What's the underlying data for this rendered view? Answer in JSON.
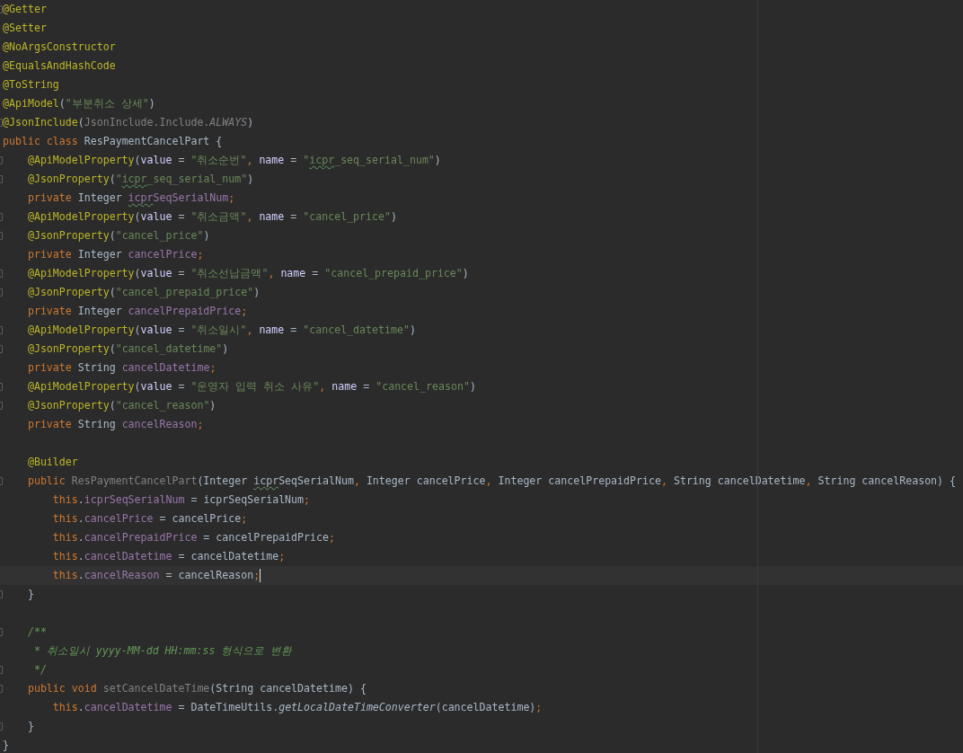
{
  "editor": {
    "lines": [
      {
        "fold": true,
        "current": false,
        "tokens": [
          {
            "kind": "annotation",
            "text": "@Getter"
          }
        ]
      },
      {
        "fold": false,
        "current": false,
        "tokens": [
          {
            "kind": "annotation",
            "text": "@Setter"
          }
        ]
      },
      {
        "fold": false,
        "current": false,
        "tokens": [
          {
            "kind": "annotation",
            "text": "@NoArgsConstructor"
          }
        ]
      },
      {
        "fold": false,
        "current": false,
        "tokens": [
          {
            "kind": "annotation",
            "text": "@EqualsAndHashCode"
          }
        ]
      },
      {
        "fold": false,
        "current": false,
        "tokens": [
          {
            "kind": "annotation",
            "text": "@ToString"
          }
        ]
      },
      {
        "fold": false,
        "current": false,
        "tokens": [
          {
            "kind": "annotation",
            "text": "@ApiModel"
          },
          {
            "kind": "plain",
            "text": "("
          },
          {
            "kind": "string",
            "text": "\"부분취소 상세\""
          },
          {
            "kind": "plain",
            "text": ")"
          }
        ]
      },
      {
        "fold": true,
        "current": false,
        "tokens": [
          {
            "kind": "annotation",
            "text": "@JsonInclude"
          },
          {
            "kind": "plain",
            "text": "("
          },
          {
            "kind": "unused",
            "text": "JsonInclude.Include."
          },
          {
            "kind": "constant",
            "text": "ALWAYS"
          },
          {
            "kind": "plain",
            "text": ")"
          }
        ]
      },
      {
        "fold": false,
        "current": false,
        "tokens": [
          {
            "kind": "keyword",
            "text": "public class "
          },
          {
            "kind": "plain",
            "text": "ResPaymentCancelPart {"
          }
        ]
      },
      {
        "fold": true,
        "current": false,
        "tokens": [
          {
            "kind": "annotation",
            "text": "    @ApiModelProperty"
          },
          {
            "kind": "plain",
            "text": "("
          },
          {
            "kind": "named",
            "text": "value"
          },
          {
            "kind": "plain",
            "text": " = "
          },
          {
            "kind": "string",
            "text": "\"취소순번\""
          },
          {
            "kind": "keyword",
            "text": ", "
          },
          {
            "kind": "named",
            "text": "name"
          },
          {
            "kind": "plain",
            "text": " = "
          },
          {
            "kind": "string",
            "text": "\""
          },
          {
            "kind": "string-typo",
            "text": "icpr"
          },
          {
            "kind": "string",
            "text": "_seq_serial_num\""
          },
          {
            "kind": "plain",
            "text": ")"
          }
        ]
      },
      {
        "fold": true,
        "current": false,
        "tokens": [
          {
            "kind": "annotation",
            "text": "    @JsonProperty"
          },
          {
            "kind": "plain",
            "text": "("
          },
          {
            "kind": "string",
            "text": "\""
          },
          {
            "kind": "string-typo",
            "text": "icpr"
          },
          {
            "kind": "string",
            "text": "_seq_serial_num\""
          },
          {
            "kind": "plain",
            "text": ")"
          }
        ]
      },
      {
        "fold": false,
        "current": false,
        "tokens": [
          {
            "kind": "keyword",
            "text": "    private "
          },
          {
            "kind": "plain",
            "text": "Integer "
          },
          {
            "kind": "field-typo",
            "text": "icpr"
          },
          {
            "kind": "field",
            "text": "SeqSerialNum"
          },
          {
            "kind": "keyword",
            "text": ";"
          }
        ]
      },
      {
        "fold": true,
        "current": false,
        "tokens": [
          {
            "kind": "annotation",
            "text": "    @ApiModelProperty"
          },
          {
            "kind": "plain",
            "text": "("
          },
          {
            "kind": "named",
            "text": "value"
          },
          {
            "kind": "plain",
            "text": " = "
          },
          {
            "kind": "string",
            "text": "\"취소금액\""
          },
          {
            "kind": "keyword",
            "text": ", "
          },
          {
            "kind": "named",
            "text": "name"
          },
          {
            "kind": "plain",
            "text": " = "
          },
          {
            "kind": "string",
            "text": "\"cancel_price\""
          },
          {
            "kind": "plain",
            "text": ")"
          }
        ]
      },
      {
        "fold": true,
        "current": false,
        "tokens": [
          {
            "kind": "annotation",
            "text": "    @JsonProperty"
          },
          {
            "kind": "plain",
            "text": "("
          },
          {
            "kind": "string",
            "text": "\"cancel_price\""
          },
          {
            "kind": "plain",
            "text": ")"
          }
        ]
      },
      {
        "fold": false,
        "current": false,
        "tokens": [
          {
            "kind": "keyword",
            "text": "    private "
          },
          {
            "kind": "plain",
            "text": "Integer "
          },
          {
            "kind": "field",
            "text": "cancelPrice"
          },
          {
            "kind": "keyword",
            "text": ";"
          }
        ]
      },
      {
        "fold": true,
        "current": false,
        "tokens": [
          {
            "kind": "annotation",
            "text": "    @ApiModelProperty"
          },
          {
            "kind": "plain",
            "text": "("
          },
          {
            "kind": "named",
            "text": "value"
          },
          {
            "kind": "plain",
            "text": " = "
          },
          {
            "kind": "string",
            "text": "\"취소선납금액\""
          },
          {
            "kind": "keyword",
            "text": ", "
          },
          {
            "kind": "named",
            "text": "name"
          },
          {
            "kind": "plain",
            "text": " = "
          },
          {
            "kind": "string",
            "text": "\"cancel_prepaid_price\""
          },
          {
            "kind": "plain",
            "text": ")"
          }
        ]
      },
      {
        "fold": true,
        "current": false,
        "tokens": [
          {
            "kind": "annotation",
            "text": "    @JsonProperty"
          },
          {
            "kind": "plain",
            "text": "("
          },
          {
            "kind": "string",
            "text": "\"cancel_prepaid_price\""
          },
          {
            "kind": "plain",
            "text": ")"
          }
        ]
      },
      {
        "fold": false,
        "current": false,
        "tokens": [
          {
            "kind": "keyword",
            "text": "    private "
          },
          {
            "kind": "plain",
            "text": "Integer "
          },
          {
            "kind": "field",
            "text": "cancelPrepaidPrice"
          },
          {
            "kind": "keyword",
            "text": ";"
          }
        ]
      },
      {
        "fold": true,
        "current": false,
        "tokens": [
          {
            "kind": "annotation",
            "text": "    @ApiModelProperty"
          },
          {
            "kind": "plain",
            "text": "("
          },
          {
            "kind": "named",
            "text": "value"
          },
          {
            "kind": "plain",
            "text": " = "
          },
          {
            "kind": "string",
            "text": "\"취소일시\""
          },
          {
            "kind": "keyword",
            "text": ", "
          },
          {
            "kind": "named",
            "text": "name"
          },
          {
            "kind": "plain",
            "text": " = "
          },
          {
            "kind": "string",
            "text": "\"cancel_datetime\""
          },
          {
            "kind": "plain",
            "text": ")"
          }
        ]
      },
      {
        "fold": true,
        "current": false,
        "tokens": [
          {
            "kind": "annotation",
            "text": "    @JsonProperty"
          },
          {
            "kind": "plain",
            "text": "("
          },
          {
            "kind": "string",
            "text": "\"cancel_datetime\""
          },
          {
            "kind": "plain",
            "text": ")"
          }
        ]
      },
      {
        "fold": false,
        "current": false,
        "tokens": [
          {
            "kind": "keyword",
            "text": "    private "
          },
          {
            "kind": "plain",
            "text": "String "
          },
          {
            "kind": "field",
            "text": "cancelDatetime"
          },
          {
            "kind": "keyword",
            "text": ";"
          }
        ]
      },
      {
        "fold": true,
        "current": false,
        "tokens": [
          {
            "kind": "annotation",
            "text": "    @ApiModelProperty"
          },
          {
            "kind": "plain",
            "text": "("
          },
          {
            "kind": "named",
            "text": "value"
          },
          {
            "kind": "plain",
            "text": " = "
          },
          {
            "kind": "string",
            "text": "\"운영자 입력 취소 사유\""
          },
          {
            "kind": "keyword",
            "text": ", "
          },
          {
            "kind": "named",
            "text": "name"
          },
          {
            "kind": "plain",
            "text": " = "
          },
          {
            "kind": "string",
            "text": "\"cancel_reason\""
          },
          {
            "kind": "plain",
            "text": ")"
          }
        ]
      },
      {
        "fold": true,
        "current": false,
        "tokens": [
          {
            "kind": "annotation",
            "text": "    @JsonProperty"
          },
          {
            "kind": "plain",
            "text": "("
          },
          {
            "kind": "string",
            "text": "\"cancel_reason\""
          },
          {
            "kind": "plain",
            "text": ")"
          }
        ]
      },
      {
        "fold": false,
        "current": false,
        "tokens": [
          {
            "kind": "keyword",
            "text": "    private "
          },
          {
            "kind": "plain",
            "text": "String "
          },
          {
            "kind": "field",
            "text": "cancelReason"
          },
          {
            "kind": "keyword",
            "text": ";"
          }
        ]
      },
      {
        "fold": false,
        "current": false
      },
      {
        "fold": false,
        "current": false,
        "tokens": [
          {
            "kind": "annotation",
            "text": "    @Builder"
          }
        ]
      },
      {
        "fold": true,
        "current": false,
        "tokens": [
          {
            "kind": "keyword",
            "text": "    public "
          },
          {
            "kind": "unused",
            "text": "ResPaymentCancelPart"
          },
          {
            "kind": "plain",
            "text": "(Integer "
          },
          {
            "kind": "plain-typo",
            "text": "icpr"
          },
          {
            "kind": "plain",
            "text": "SeqSerialNum"
          },
          {
            "kind": "keyword",
            "text": ", "
          },
          {
            "kind": "plain",
            "text": "Integer cancelPrice"
          },
          {
            "kind": "keyword",
            "text": ", "
          },
          {
            "kind": "plain",
            "text": "Integer cancelPrepaidPrice"
          },
          {
            "kind": "keyword",
            "text": ", "
          },
          {
            "kind": "plain",
            "text": "String cancelDatetime"
          },
          {
            "kind": "keyword",
            "text": ", "
          },
          {
            "kind": "plain",
            "text": "String cancelReason) {"
          }
        ]
      },
      {
        "fold": false,
        "current": false,
        "tokens": [
          {
            "kind": "keyword",
            "text": "        this"
          },
          {
            "kind": "plain",
            "text": "."
          },
          {
            "kind": "field",
            "text": "icprSeqSerialNum"
          },
          {
            "kind": "plain",
            "text": " = icprSeqSerialNum"
          },
          {
            "kind": "keyword",
            "text": ";"
          }
        ]
      },
      {
        "fold": false,
        "current": false,
        "tokens": [
          {
            "kind": "keyword",
            "text": "        this"
          },
          {
            "kind": "plain",
            "text": "."
          },
          {
            "kind": "field",
            "text": "cancelPrice"
          },
          {
            "kind": "plain",
            "text": " = cancelPrice"
          },
          {
            "kind": "keyword",
            "text": ";"
          }
        ]
      },
      {
        "fold": false,
        "current": false,
        "tokens": [
          {
            "kind": "keyword",
            "text": "        this"
          },
          {
            "kind": "plain",
            "text": "."
          },
          {
            "kind": "field",
            "text": "cancelPrepaidPrice"
          },
          {
            "kind": "plain",
            "text": " = cancelPrepaidPrice"
          },
          {
            "kind": "keyword",
            "text": ";"
          }
        ]
      },
      {
        "fold": false,
        "current": false,
        "tokens": [
          {
            "kind": "keyword",
            "text": "        this"
          },
          {
            "kind": "plain",
            "text": "."
          },
          {
            "kind": "field",
            "text": "cancelDatetime"
          },
          {
            "kind": "plain",
            "text": " = cancelDatetime"
          },
          {
            "kind": "keyword",
            "text": ";"
          }
        ]
      },
      {
        "fold": false,
        "current": true,
        "tokens": [
          {
            "kind": "keyword",
            "text": "        this"
          },
          {
            "kind": "plain",
            "text": "."
          },
          {
            "kind": "field",
            "text": "cancelReason"
          },
          {
            "kind": "plain",
            "text": " = cancelReason"
          },
          {
            "kind": "keyword",
            "text": ";"
          }
        ]
      },
      {
        "fold": true,
        "current": false,
        "tokens": [
          {
            "kind": "plain",
            "text": "    }"
          }
        ]
      },
      {
        "fold": false,
        "current": false
      },
      {
        "fold": true,
        "current": false,
        "tokens": [
          {
            "kind": "doc",
            "text": "    /**"
          }
        ]
      },
      {
        "fold": false,
        "current": false,
        "tokens": [
          {
            "kind": "doc",
            "text": "     * 취소일시 yyyy-MM-dd HH:mm:ss 형식으로 변환"
          }
        ]
      },
      {
        "fold": true,
        "current": false,
        "tokens": [
          {
            "kind": "doc",
            "text": "     */"
          }
        ]
      },
      {
        "fold": true,
        "current": false,
        "tokens": [
          {
            "kind": "keyword",
            "text": "    public void "
          },
          {
            "kind": "unused",
            "text": "setCancelDateTime"
          },
          {
            "kind": "plain",
            "text": "(String cancelDatetime) {"
          }
        ]
      },
      {
        "fold": false,
        "current": false,
        "tokens": [
          {
            "kind": "keyword",
            "text": "        this"
          },
          {
            "kind": "plain",
            "text": "."
          },
          {
            "kind": "field",
            "text": "cancelDatetime"
          },
          {
            "kind": "plain",
            "text": " = DateTimeUtils."
          },
          {
            "kind": "static-call",
            "text": "getLocalDateTimeConverter"
          },
          {
            "kind": "plain",
            "text": "(cancelDatetime)"
          },
          {
            "kind": "keyword",
            "text": ";"
          }
        ]
      },
      {
        "fold": true,
        "current": false,
        "tokens": [
          {
            "kind": "plain",
            "text": "    }"
          }
        ]
      },
      {
        "fold": false,
        "current": false,
        "tokens": [
          {
            "kind": "plain",
            "text": "}"
          }
        ]
      }
    ]
  }
}
